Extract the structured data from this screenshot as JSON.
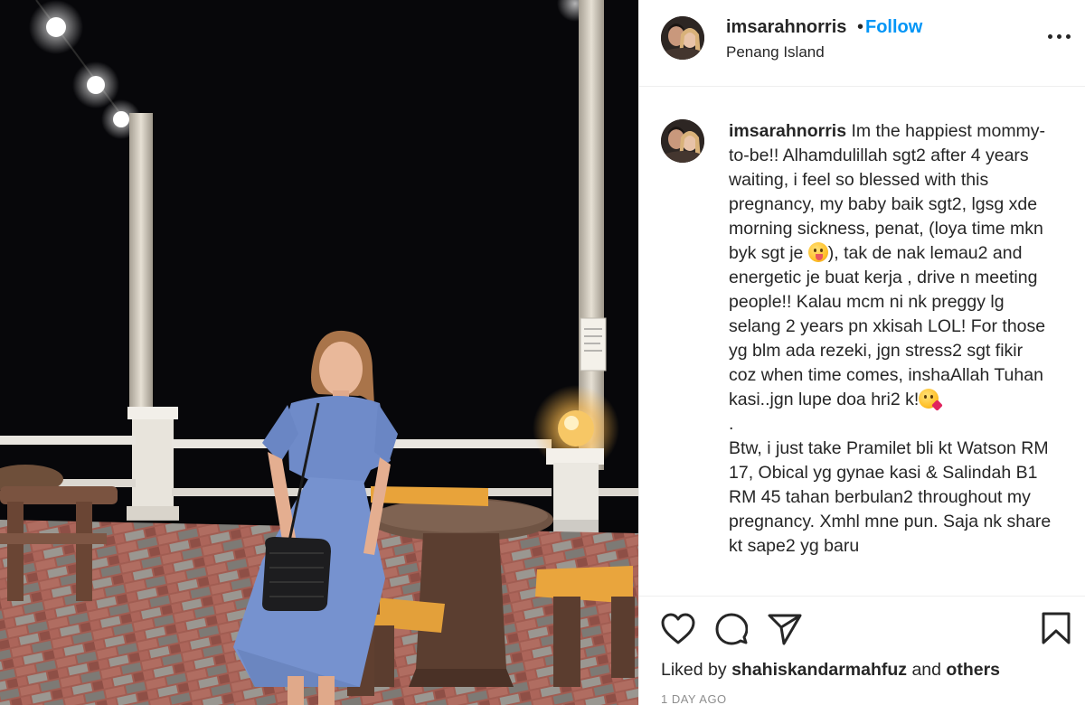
{
  "photo": {
    "alt_subject": "Woman in blue dress posing at a night-time seaside terrace"
  },
  "header": {
    "username": "imsarahnorris",
    "separator": "•",
    "follow_label": "Follow",
    "location": "Penang Island",
    "more_icon": "more-horizontal-icon"
  },
  "caption": {
    "username": "imsarahnorris",
    "part1": " Im the happiest mommy-to-be!! Alhamdulillah sgt2 after 4 years waiting, i feel so blessed with this pregnancy, my baby baik sgt2, lgsg xde morning sickness, penat, (loya time mkn byk sgt je ",
    "part2": "), tak de nak lemau2 and energetic je buat kerja , drive n meeting people!! Kalau mcm ni nk preggy lg selang 2 years pn xkisah LOL! For those yg blm ada rezeki, jgn stress2 sgt fikir coz when time comes, inshaAllah Tuhan kasi..jgn lupe doa hri2 k!",
    "part3": "\n.\nBtw, i just take Pramilet bli kt Watson RM 17, Obical yg gynae kasi & Salindah B1 RM 45 tahan berbulan2 throughout my pregnancy. Xmhl mne pun. Saja nk share kt sape2 yg baru",
    "emoji1": "zany-face-emoji",
    "emoji2": "kissing-face-emoji"
  },
  "actions": {
    "like_icon": "heart-icon",
    "comment_icon": "comment-icon",
    "share_icon": "send-icon",
    "save_icon": "bookmark-icon"
  },
  "likes": {
    "prefix": "Liked by ",
    "user": "shahiskandarmahfuz",
    "middle": " and ",
    "others": "others"
  },
  "timestamp": "1 DAY AGO",
  "colors": {
    "follow_blue": "#0095f6",
    "text": "#262626",
    "muted": "#8e8e8e",
    "dress_blue": "#6f8bc9"
  }
}
